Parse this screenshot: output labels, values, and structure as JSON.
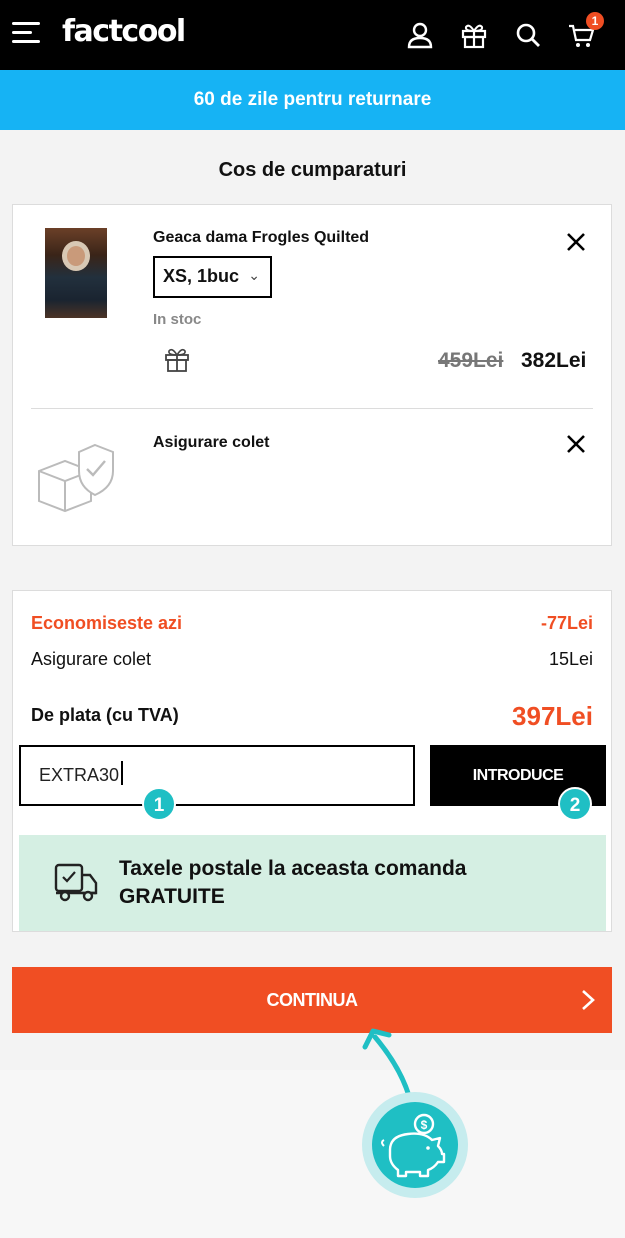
{
  "header": {
    "logo": "factcool",
    "icons": [
      "menu-icon",
      "account-icon",
      "gift-icon",
      "search-icon",
      "cart-icon"
    ],
    "cart_count": "1"
  },
  "banner": {
    "text": "60 de zile pentru returnare"
  },
  "page_title": "Cos de cumparaturi",
  "cart": {
    "items": [
      {
        "name": "Geaca dama Frogles Quilted",
        "variant": "XS, 1buc",
        "stock": "In stoc",
        "old_price": "459Lei",
        "price": "382Lei"
      },
      {
        "name": "Asigurare colet"
      }
    ]
  },
  "summary": {
    "savings_label": "Economiseste azi",
    "savings_value": "-77Lei",
    "insurance_label": "Asigurare colet",
    "insurance_value": "15Lei",
    "total_label": "De plata (cu TVA)",
    "total_value": "397Lei"
  },
  "promo": {
    "value": "EXTRA30",
    "apply_label": "INTRODUCE"
  },
  "steps": [
    "1",
    "2"
  ],
  "shipping": {
    "line1": "Taxele postale la aceasta comanda",
    "line2": "GRATUITE"
  },
  "continue_label": "CONTINUA",
  "colors": {
    "accent": "#f04e23",
    "banner": "#16b3f4",
    "step": "#1fbfc4",
    "shipping_bg": "#d5efe3"
  }
}
